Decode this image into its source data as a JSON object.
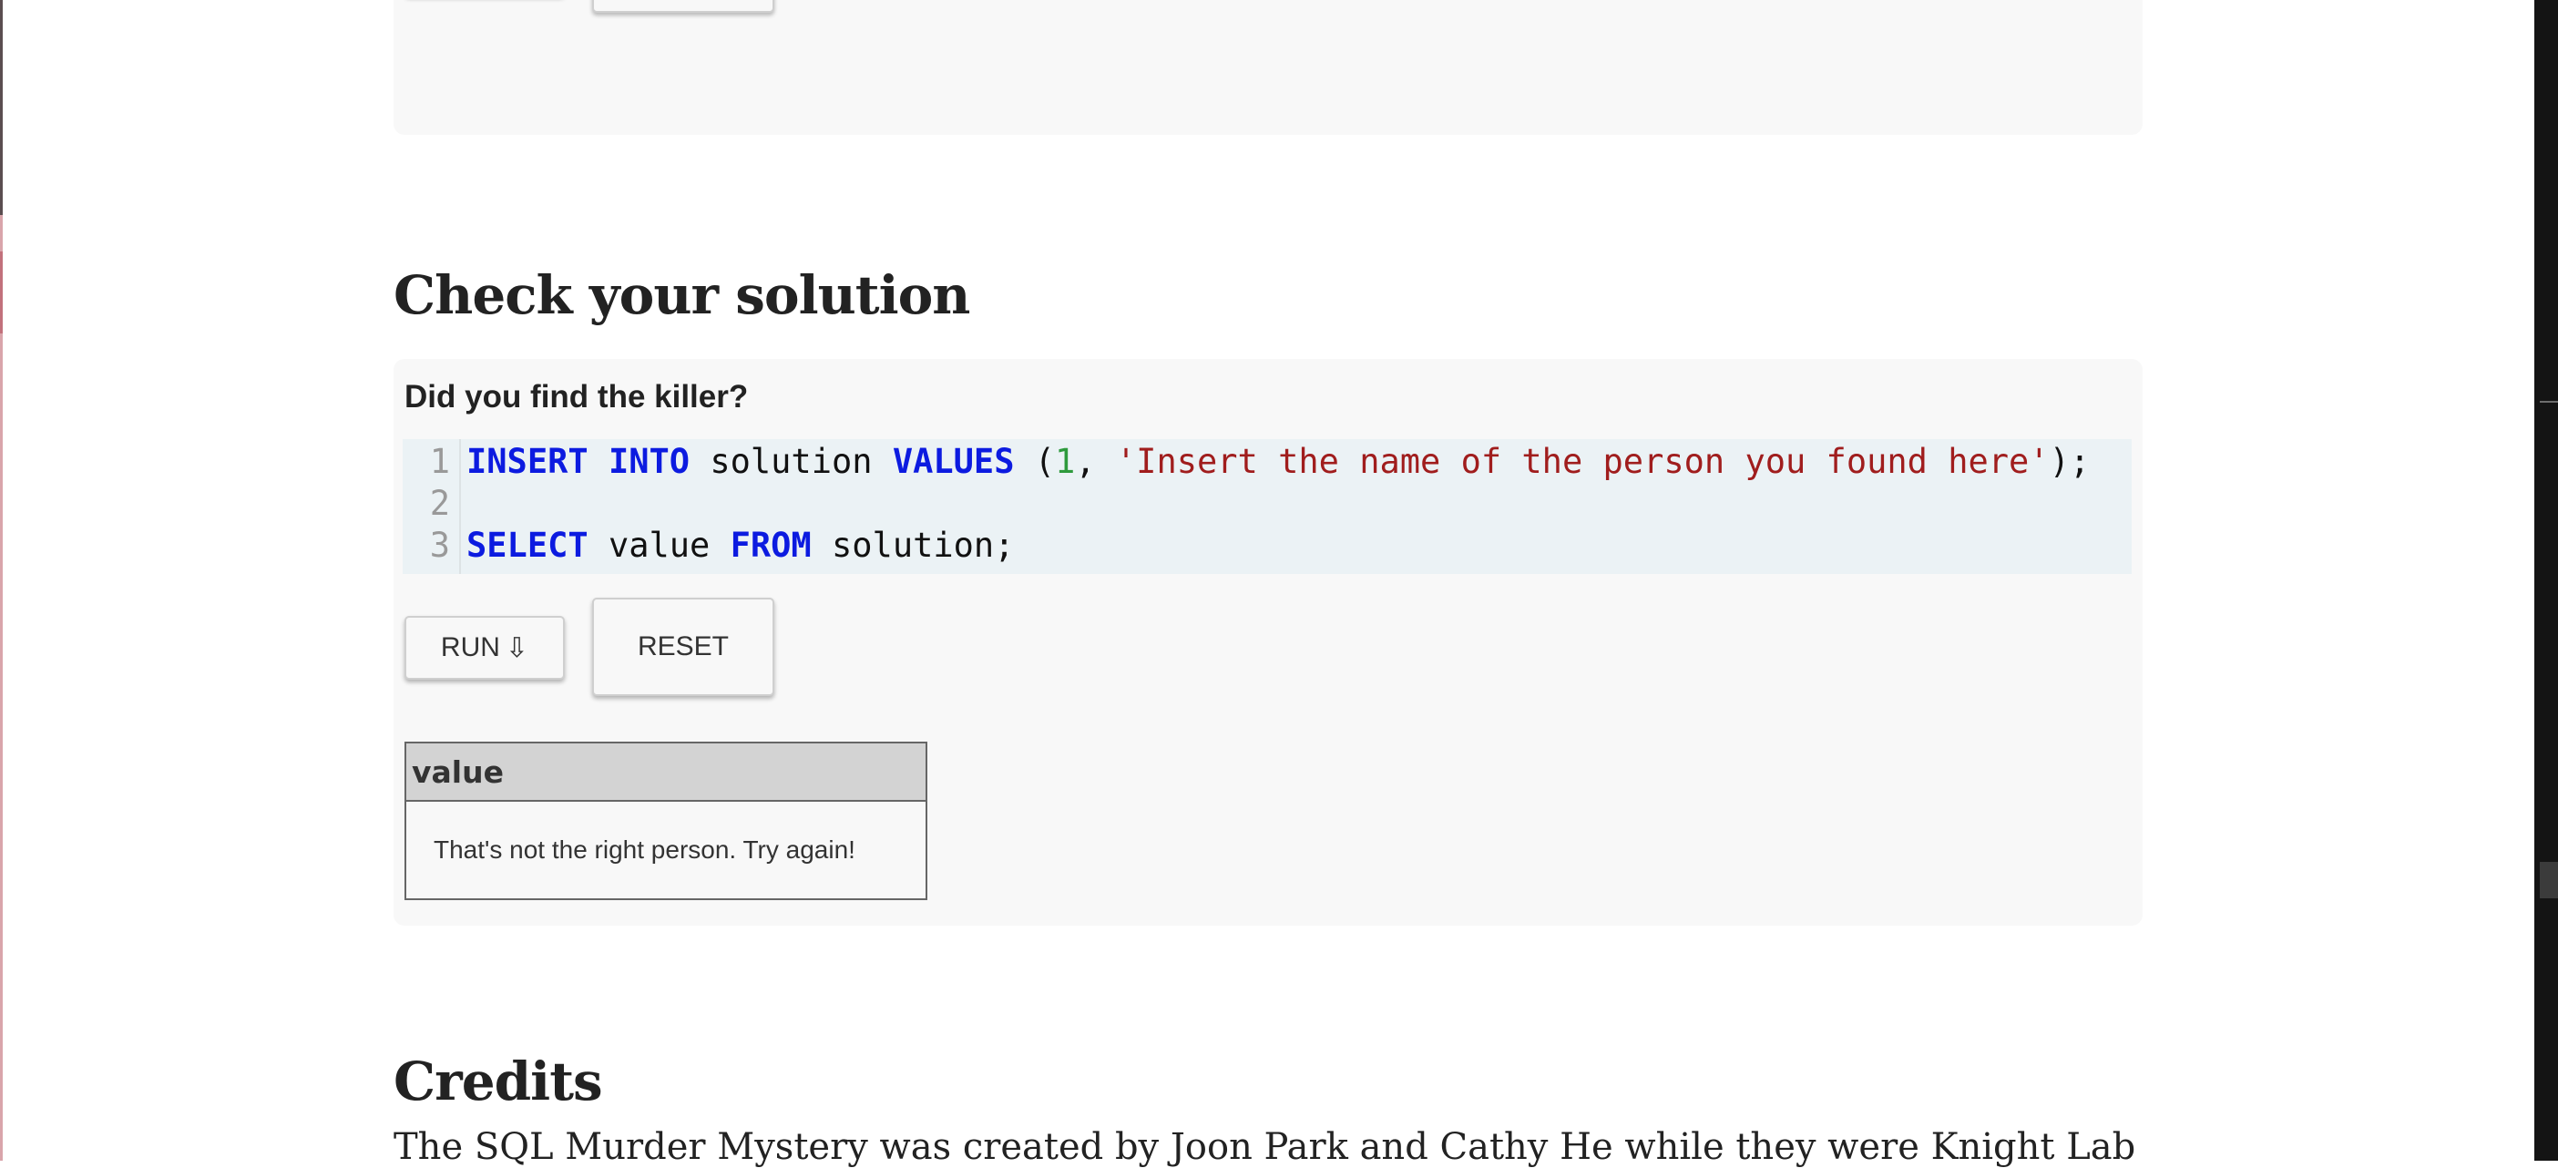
{
  "previous_exercise": {
    "run_label": "",
    "reset_label": ""
  },
  "check_section": {
    "heading": "Check your solution",
    "prompt": "Did you find the killer?",
    "editor": {
      "line_numbers": [
        "1",
        "2",
        "3"
      ],
      "line1": {
        "kw_insert": "INSERT",
        "kw_into": "INTO",
        "table": "solution",
        "kw_values": "VALUES",
        "open_paren": "(",
        "number": "1",
        "comma": ",",
        "string": "'Insert the name of the person you found here'",
        "close": ");"
      },
      "line3": {
        "kw_select": "SELECT",
        "column": "value",
        "kw_from": "FROM",
        "table_end": "solution;"
      }
    },
    "run_button": {
      "label": "RUN",
      "icon": "down-arrow-icon",
      "glyph": "⇩"
    },
    "reset_button": {
      "label": "RESET"
    },
    "result": {
      "columns": [
        "value"
      ],
      "rows": [
        [
          "That's not the right person. Try again!"
        ]
      ]
    }
  },
  "credits": {
    "heading": "Credits",
    "text": "The SQL Murder Mystery was created by Joon Park and Cathy He while they were Knight Lab"
  },
  "colors": {
    "keyword": "#0c1be0",
    "number": "#2e9a3c",
    "string": "#a01d1d",
    "panel_bg": "#f8f8f8",
    "editor_bg": "#ebf2f5",
    "table_header_bg": "#d3d3d3"
  }
}
